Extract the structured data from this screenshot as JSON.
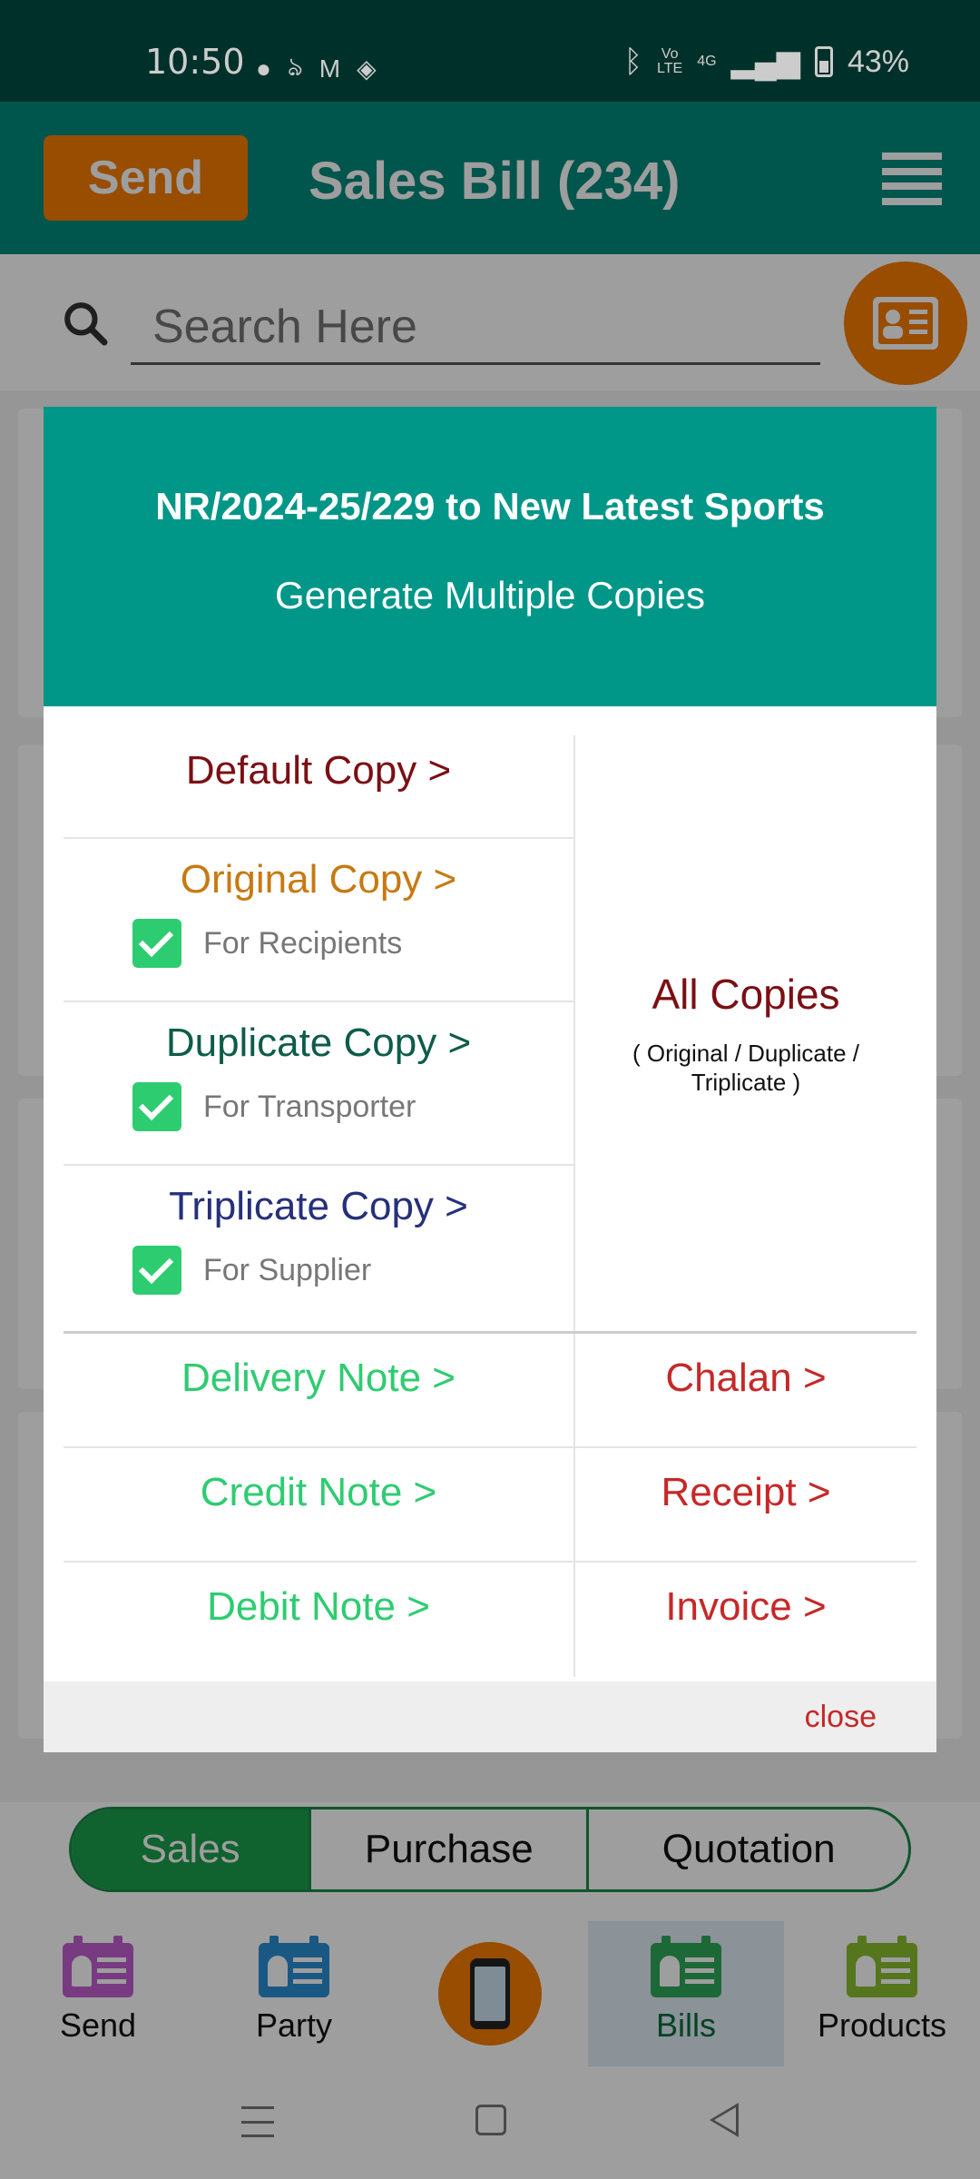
{
  "status_bar": {
    "time": "10:50",
    "battery": "43%",
    "network": "4G",
    "volte_top": "Vo",
    "volte_bottom": "LTE",
    "icons_left": [
      "chat-bubble-icon",
      "app-icon",
      "gmail-icon",
      "maps-icon"
    ],
    "icons_right": [
      "bluetooth-icon",
      "volte-icon",
      "signal-icon",
      "battery-icon"
    ]
  },
  "header": {
    "send_label": "Send",
    "title": "Sales Bill (234)"
  },
  "search": {
    "placeholder": "Search Here"
  },
  "dialog": {
    "title": "NR/2024-25/229 to New Latest Sports",
    "subtitle": "Generate Multiple Copies",
    "copies": [
      {
        "label": "Default Copy >",
        "color": "#7b0f14"
      },
      {
        "label": "Original Copy >",
        "color": "#c77a12",
        "checkbox_label": "For Recipients",
        "checked": true
      },
      {
        "label": "Duplicate Copy >",
        "color": "#0d5c4a",
        "checkbox_label": "For Transporter",
        "checked": true
      },
      {
        "label": "Triplicate Copy >",
        "color": "#26307a",
        "checkbox_label": "For Supplier",
        "checked": true
      }
    ],
    "all_copies": {
      "title": "All Copies",
      "subtitle": "( Original / Duplicate / Triplicate )"
    },
    "documents": [
      {
        "left": "Delivery Note >",
        "right": "Chalan >"
      },
      {
        "left": "Credit Note >",
        "right": "Receipt >"
      },
      {
        "left": "Debit Note >",
        "right": "Invoice >"
      }
    ],
    "close_label": "close"
  },
  "segments": [
    {
      "label": "Sales",
      "active": true
    },
    {
      "label": "Purchase",
      "active": false
    },
    {
      "label": "Quotation",
      "active": false
    }
  ],
  "bottom_nav": [
    {
      "label": "Send",
      "icon": "send-card-icon",
      "color": "#c25fd1"
    },
    {
      "label": "Party",
      "icon": "party-card-icon",
      "color": "#2b8fd6"
    },
    {
      "label": "",
      "icon": "phone-report-icon",
      "color": "#f57c00"
    },
    {
      "label": "Bills",
      "icon": "bills-card-icon",
      "color": "#2eaa5a",
      "active": true
    },
    {
      "label": "Products",
      "icon": "products-card-icon",
      "color": "#8bbf2f"
    }
  ],
  "colors": {
    "primary": "#00897b",
    "accent": "#f57c00",
    "link_green": "#2ecc71",
    "link_red": "#c62828"
  }
}
